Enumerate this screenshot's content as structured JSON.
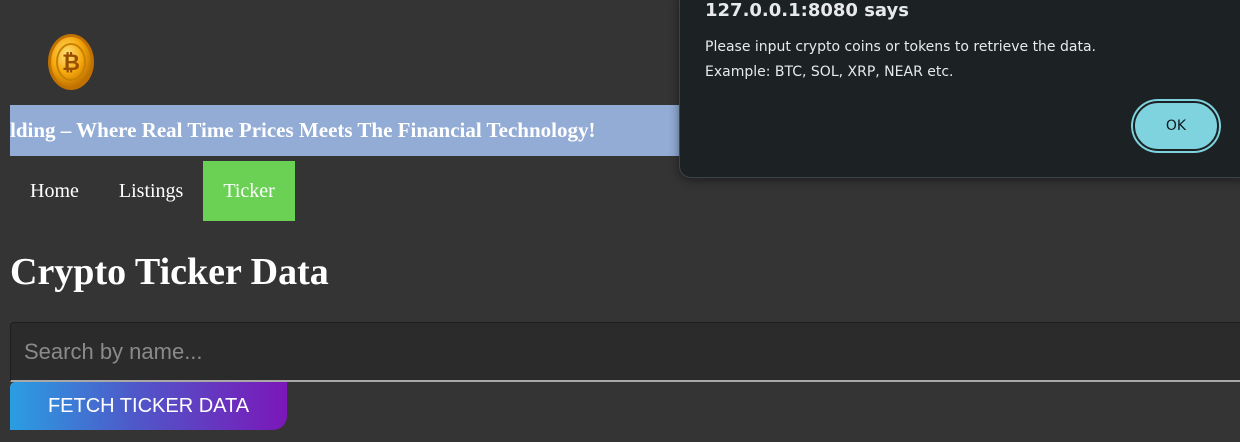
{
  "header": {
    "logo_icon": "bitcoin-coin-logo"
  },
  "marquee": {
    "text": "lding – Where Real Time Prices Meets The Financial Technology!"
  },
  "nav": {
    "items": [
      {
        "label": "Home",
        "active": false
      },
      {
        "label": "Listings",
        "active": false
      },
      {
        "label": "Ticker",
        "active": true
      }
    ]
  },
  "main": {
    "title": "Crypto Ticker Data",
    "search": {
      "placeholder": "Search by name...",
      "value": ""
    },
    "fetch_button_label": "FETCH TICKER DATA"
  },
  "dialog": {
    "title": "127.0.0.1:8080 says",
    "message_line1": "Please input crypto coins or tokens to retrieve the data.",
    "message_line2": "Example: BTC, SOL, XRP, NEAR etc.",
    "ok_label": "OK"
  },
  "colors": {
    "background": "#343434",
    "marquee_bg": "#93acd5",
    "nav_active": "#6bd155",
    "dialog_bg": "#1c2124",
    "ok_button": "#7fd3de"
  }
}
